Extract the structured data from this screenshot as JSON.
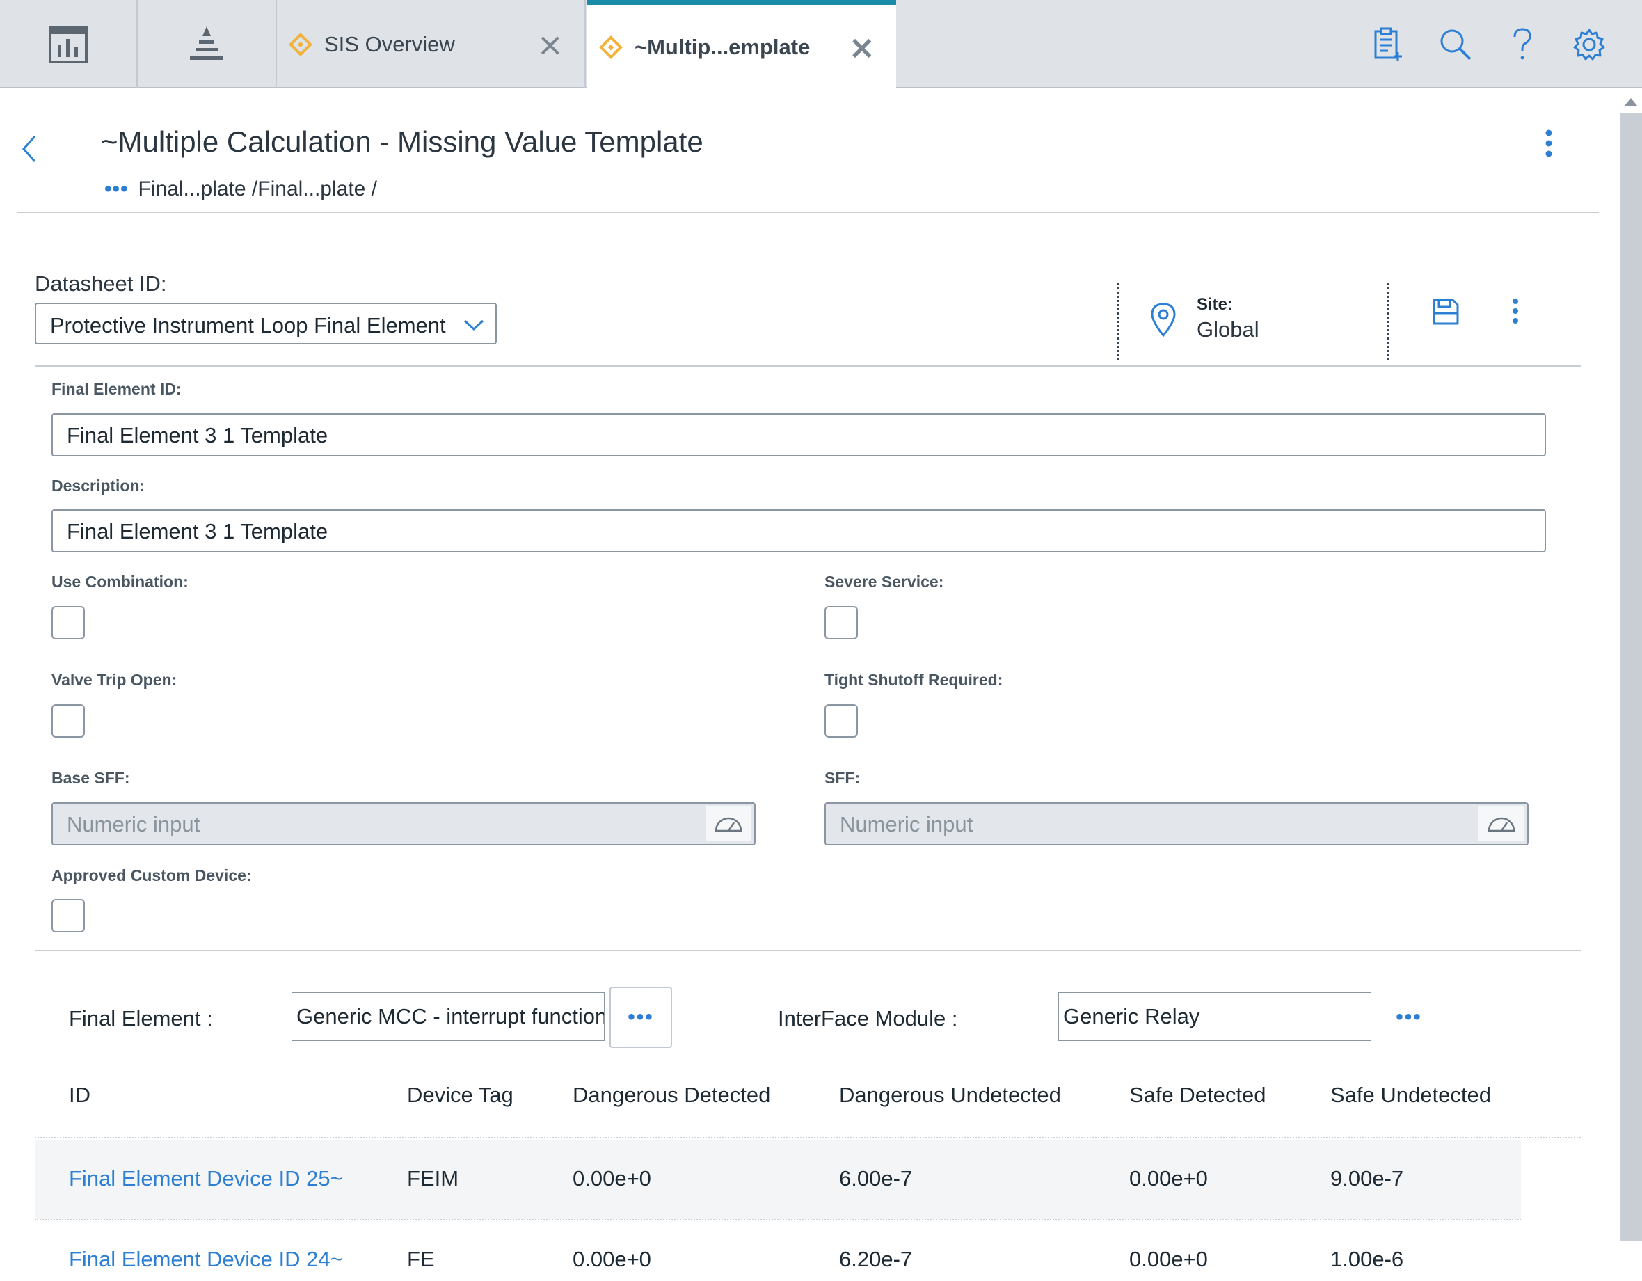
{
  "tabs": {
    "inactive": {
      "label": "SIS Overview"
    },
    "active": {
      "label": "~Multip...emplate"
    }
  },
  "header": {
    "title": "~Multiple Calculation - Missing Value Template",
    "breadcrumb": "Final...plate /Final...plate /"
  },
  "datasheet": {
    "label": "Datasheet ID:",
    "selected": "Protective Instrument Loop Final Element",
    "site_label": "Site:",
    "site_value": "Global"
  },
  "form": {
    "final_element_id_label": "Final Element ID:",
    "final_element_id_value": "Final Element 3 1 Template",
    "description_label": "Description:",
    "description_value": "Final Element 3 1 Template",
    "use_combination_label": "Use Combination:",
    "severe_service_label": "Severe Service:",
    "valve_trip_open_label": "Valve Trip Open:",
    "tight_shutoff_label": "Tight Shutoff Required:",
    "base_sff_label": "Base SFF:",
    "base_sff_placeholder": "Numeric input",
    "sff_label": "SFF:",
    "sff_placeholder": "Numeric input",
    "approved_custom_label": "Approved Custom Device:"
  },
  "lookup": {
    "final_element_label": "Final Element :",
    "final_element_value": "Generic MCC - interrupt function",
    "interface_label": "InterFace Module :",
    "interface_value": "Generic Relay",
    "dots": "•••"
  },
  "table": {
    "headers": [
      "ID",
      "Device Tag",
      "Dangerous Detected",
      "Dangerous Undetected",
      "Safe Detected",
      "Safe Undetected"
    ],
    "rows": [
      [
        "Final Element Device ID 25~",
        "FEIM",
        "0.00e+0",
        "6.00e-7",
        "0.00e+0",
        "9.00e-7"
      ],
      [
        "Final Element Device ID 24~",
        "FE",
        "0.00e+0",
        "6.20e-7",
        "0.00e+0",
        "1.00e-6"
      ]
    ]
  },
  "colors": {
    "accent": "#1a8ca8",
    "link": "#2d7fd3",
    "tab_icon": "#f3b23b"
  }
}
